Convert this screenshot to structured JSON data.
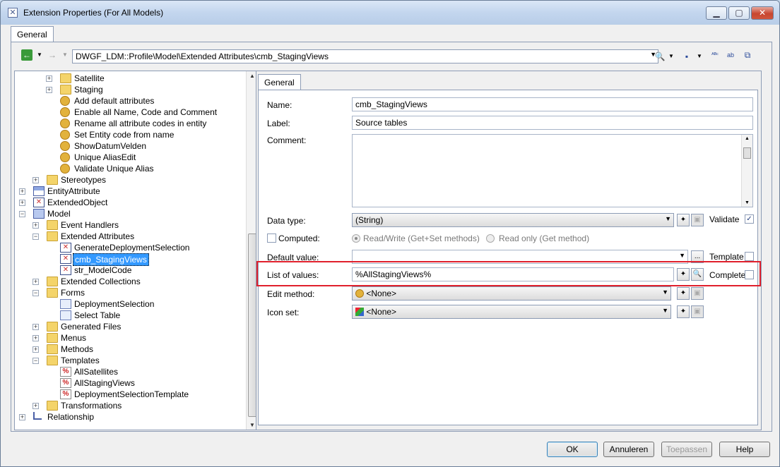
{
  "window": {
    "title": "Extension Properties (For All Models)",
    "top_tab": "General"
  },
  "toolbar": {
    "path": "DWGF_LDM::Profile\\Model\\Extended Attributes\\cmb_StagingViews"
  },
  "tree": {
    "items": [
      {
        "label": "Satellite",
        "icon": "folder-icon",
        "expand": "+"
      },
      {
        "label": "Staging",
        "icon": "folder-icon",
        "expand": "+"
      },
      {
        "label": "Add default attributes",
        "icon": "method-gear-icon"
      },
      {
        "label": "Enable all Name, Code and Comment",
        "icon": "method-gear-icon"
      },
      {
        "label": "Rename all attribute codes in entity",
        "icon": "method-gear-icon"
      },
      {
        "label": "Set Entity code from name",
        "icon": "method-gear-icon"
      },
      {
        "label": "ShowDatumVelden",
        "icon": "method-gear-icon"
      },
      {
        "label": "Unique AliasEdit",
        "icon": "method-gear-icon"
      },
      {
        "label": "Validate Unique Alias",
        "icon": "method-gear-icon"
      },
      {
        "label": "Stereotypes",
        "icon": "folder-icon",
        "expand": "+"
      },
      {
        "label": "EntityAttribute",
        "icon": "entity-attribute-icon",
        "expand": "+"
      },
      {
        "label": "ExtendedObject",
        "icon": "extended-object-icon",
        "expand": "+"
      },
      {
        "label": "Model",
        "icon": "model-icon",
        "expand": "-"
      },
      {
        "label": "Event Handlers",
        "icon": "folder-icon",
        "expand": "+"
      },
      {
        "label": "Extended Attributes",
        "icon": "folder-icon",
        "expand": "-"
      },
      {
        "label": "GenerateDeploymentSelection",
        "icon": "extended-attribute-icon"
      },
      {
        "label": "cmb_StagingViews",
        "icon": "extended-attribute-icon",
        "selected": true
      },
      {
        "label": "str_ModelCode",
        "icon": "extended-attribute-icon"
      },
      {
        "label": "Extended Collections",
        "icon": "folder-icon",
        "expand": "+"
      },
      {
        "label": "Forms",
        "icon": "folder-icon",
        "expand": "-"
      },
      {
        "label": "DeploymentSelection",
        "icon": "form-icon"
      },
      {
        "label": "Select Table",
        "icon": "form-icon"
      },
      {
        "label": "Generated Files",
        "icon": "folder-icon",
        "expand": "+"
      },
      {
        "label": "Menus",
        "icon": "folder-icon",
        "expand": "+"
      },
      {
        "label": "Methods",
        "icon": "folder-icon",
        "expand": "+"
      },
      {
        "label": "Templates",
        "icon": "folder-icon",
        "expand": "-"
      },
      {
        "label": "AllSatellites",
        "icon": "template-icon"
      },
      {
        "label": "AllStagingViews",
        "icon": "template-icon"
      },
      {
        "label": "DeploymentSelectionTemplate",
        "icon": "template-icon"
      },
      {
        "label": "Transformations",
        "icon": "folder-icon",
        "expand": "+"
      },
      {
        "label": "Relationship",
        "icon": "relationship-icon",
        "expand": "+"
      }
    ]
  },
  "props": {
    "tab": "General",
    "name_label": "Name:",
    "name_value": "cmb_StagingViews",
    "label_label": "Label:",
    "label_value": "Source tables",
    "comment_label": "Comment:",
    "datatype_label": "Data type:",
    "datatype_value": "(String)",
    "validate_label": "Validate",
    "computed_label": "Computed:",
    "readwrite_label": "Read/Write (Get+Set methods)",
    "readonly_label": "Read only (Get method)",
    "default_label": "Default value:",
    "default_button": "...",
    "template_label": "Template",
    "lov_label": "List of values:",
    "lov_value": "%AllStagingViews%",
    "complete_label": "Complete",
    "edit_method_label": "Edit method:",
    "edit_method_value": "<None>",
    "icon_set_label": "Icon set:",
    "icon_set_value": "<None>"
  },
  "buttons": {
    "ok": "OK",
    "cancel": "Annuleren",
    "apply": "Toepassen",
    "help": "Help"
  },
  "colors": {
    "selection": "#3399ff",
    "highlight_box": "#e0202c"
  }
}
